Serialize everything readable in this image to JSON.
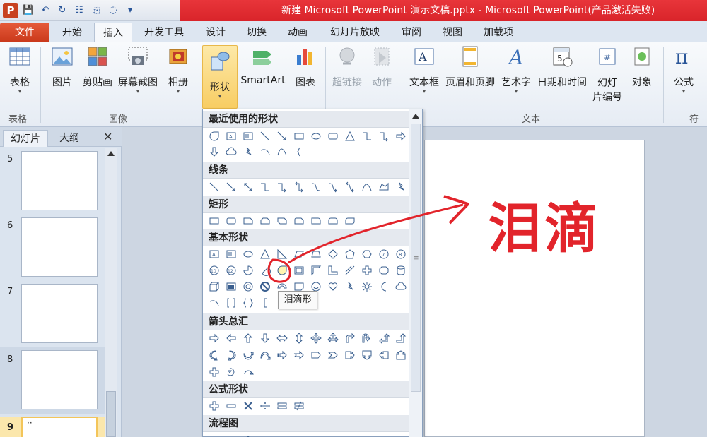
{
  "window": {
    "title": "新建 Microsoft PowerPoint 演示文稿.pptx - Microsoft PowerPoint(产品激活失败)",
    "app_icon_letter": "P",
    "qat_icons": [
      "save-icon",
      "undo-icon",
      "redo-icon",
      "find-icon",
      "paste-icon",
      "clock-icon",
      "customize-icon"
    ]
  },
  "tabs": [
    "文件",
    "开始",
    "插入",
    "开发工具",
    "设计",
    "切换",
    "动画",
    "幻灯片放映",
    "审阅",
    "视图",
    "加载项"
  ],
  "active_tab": "插入",
  "ribbon": {
    "table": "表格",
    "picture": "图片",
    "clipart": "剪贴画",
    "screenshot": "屏幕截图",
    "album": "相册",
    "shapes": "形状",
    "smartart": "SmartArt",
    "chart": "图表",
    "hyperlink": "超链接",
    "action": "动作",
    "textbox": "文本框",
    "header_footer": "页眉和页脚",
    "wordart": "艺术字",
    "datetime": "日期和时间",
    "slide_number_1": "幻灯",
    "slide_number_2": "片编号",
    "object": "对象",
    "equation": "公式",
    "groups": {
      "tables": "表格",
      "images": "图像",
      "text": "文本",
      "symbols": "符号"
    }
  },
  "left_pane": {
    "tab_slides": "幻灯片",
    "tab_outline": "大纲",
    "close": "✕",
    "slide_numbers": [
      "5",
      "6",
      "7",
      "8",
      "9"
    ],
    "slide9_text": "··"
  },
  "shapes_menu": {
    "categories": {
      "recent": "最近使用的形状",
      "lines": "线条",
      "rectangles": "矩形",
      "basic": "基本形状",
      "arrows": "箭头总汇",
      "equation": "公式形状",
      "flowchart": "流程图"
    },
    "tooltip": "泪滴形"
  },
  "annotation": {
    "text": "泪滴",
    "color": "#e2242b"
  }
}
